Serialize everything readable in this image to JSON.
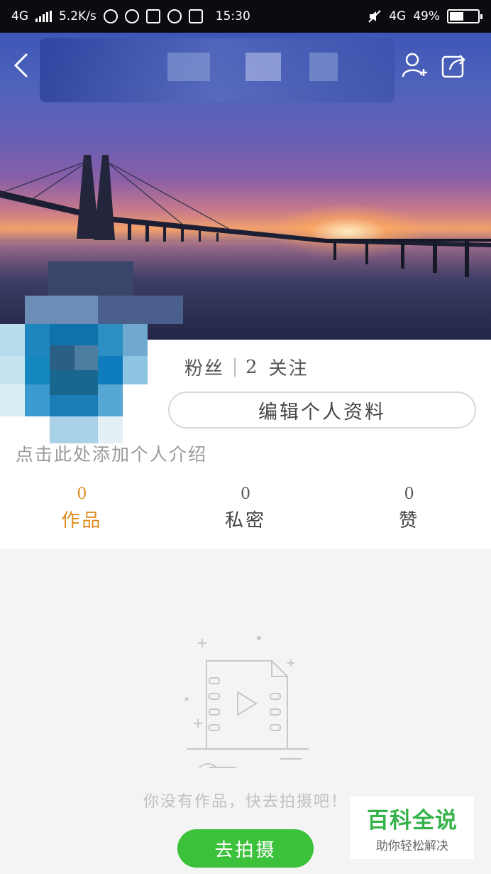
{
  "status_bar": {
    "network_left": "4G",
    "speed": "5.2K/s",
    "time": "15:30",
    "network_right": "4G",
    "battery": "49%",
    "battery_level": 0.49
  },
  "header": {
    "back_icon": "chevron-left-icon",
    "add_friend_icon": "add-user-icon",
    "share_icon": "share-icon"
  },
  "profile": {
    "fans_label": "粉丝",
    "follow_count": "2",
    "follow_label": "关注",
    "edit_button": "编辑个人资料",
    "bio_placeholder": "点击此处添加个人介绍"
  },
  "tabs": [
    {
      "count": "0",
      "label": "作品",
      "active": true
    },
    {
      "count": "0",
      "label": "私密",
      "active": false
    },
    {
      "count": "0",
      "label": "赞",
      "active": false
    }
  ],
  "empty_state": {
    "icon": "video-file-icon",
    "message": "你没有作品，快去拍摄吧！",
    "shoot_button": "去拍摄"
  },
  "watermark": {
    "main": "百科全说",
    "sub": "助你轻松解决"
  },
  "colors": {
    "accent_active_tab": "#e08b1d",
    "primary_button": "#3cc13b",
    "watermark_green": "#35b34a"
  }
}
